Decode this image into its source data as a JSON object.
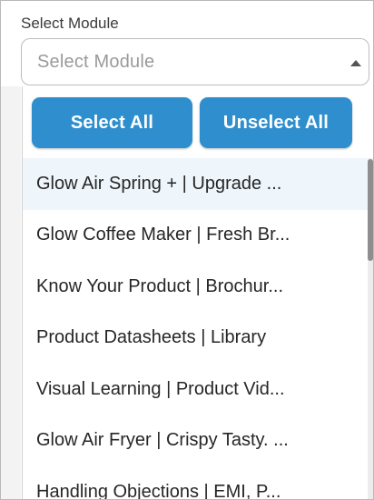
{
  "field": {
    "label": "Select Module",
    "placeholder": "Select Module",
    "caret_icon": "caret-up-icon"
  },
  "actions": {
    "select_all": "Select All",
    "unselect_all": "Unselect All"
  },
  "options": [
    "Glow Air Spring + | Upgrade ...",
    "Glow Coffee Maker | Fresh Br...",
    "Know Your Product | Brochur...",
    "Product Datasheets | Library",
    "Visual Learning | Product Vid...",
    "Glow Air Fryer | Crispy Tasty. ...",
    "Handling Objections | EMI, P..."
  ],
  "colors": {
    "accent": "#2f8fce",
    "highlight": "#eef5fb"
  }
}
